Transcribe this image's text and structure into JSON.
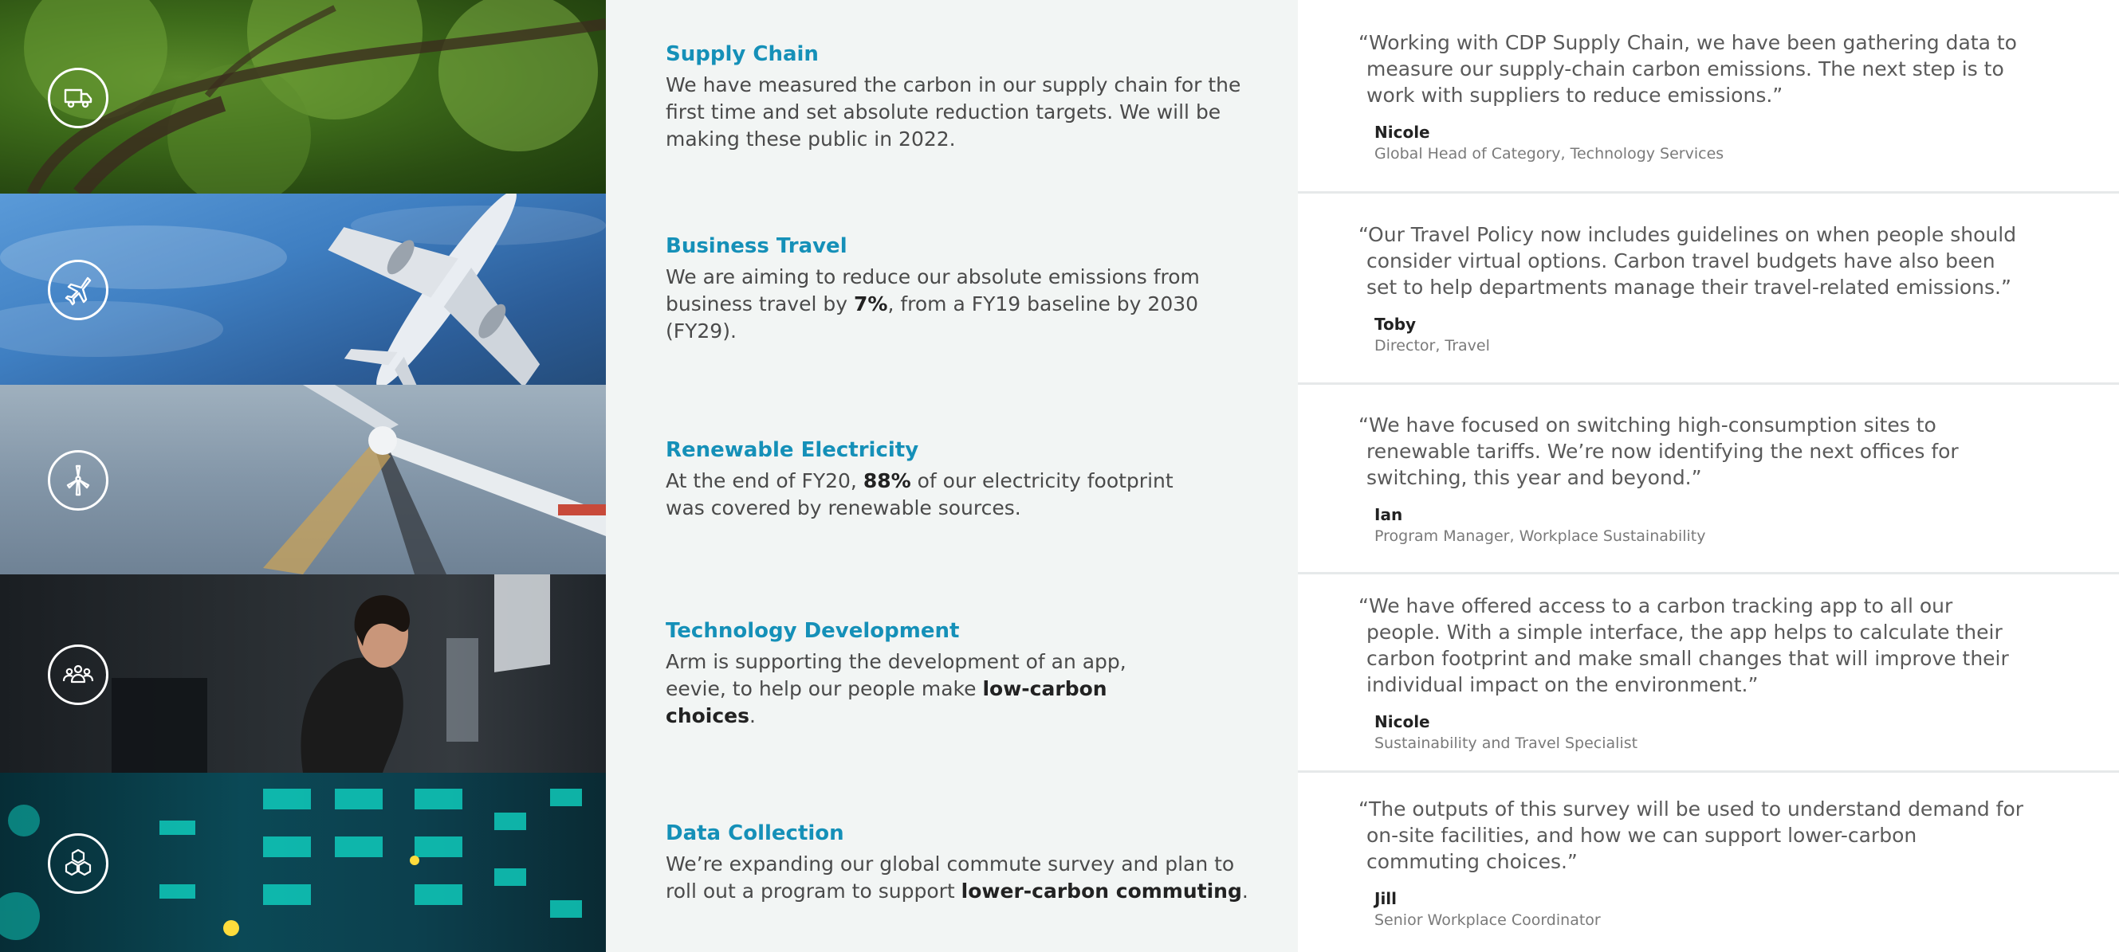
{
  "rows": [
    {
      "title": "Supply Chain",
      "body": [
        {
          "text": "We have measured the carbon in our supply chain for the first time and set absolute reduction targets. We will be making these public in 2022."
        }
      ],
      "quote": "“Working with CDP Supply Chain, we have been gathering data to measure our supply-chain carbon emissions. The next step is to work with suppliers to reduce emissions.”",
      "name": "Nicole",
      "role": "Global Head of Category, Technology Services",
      "icon": "delivery-truck-icon"
    },
    {
      "title": "Business Travel",
      "body": [
        {
          "text": "We are aiming to reduce our absolute emissions from business travel by "
        },
        {
          "bold": "7%"
        },
        {
          "text": ", from a FY19 baseline by 2030 (FY29)."
        }
      ],
      "quote": "“Our Travel Policy now includes guidelines on when people should consider virtual options. Carbon travel budgets have also been set to help departments manage their travel-related emissions.”",
      "name": "Toby",
      "role": "Director, Travel",
      "icon": "airplane-icon"
    },
    {
      "title": "Renewable Electricity",
      "body": [
        {
          "text": "At the end of FY20, "
        },
        {
          "bold": "88%"
        },
        {
          "text": " of our electricity footprint was covered by renewable sources."
        }
      ],
      "quote": "“We have focused on switching high-consumption sites to renewable tariffs. We’re now identifying the next offices for switching, this year and beyond.”",
      "name": "Ian",
      "role": "Program Manager, Workplace Sustainability",
      "icon": "wind-turbine-icon"
    },
    {
      "title": "Technology Development",
      "body": [
        {
          "text": "Arm is supporting the development of an app, eevie, to help our people make "
        },
        {
          "bold": "low-carbon choices"
        },
        {
          "text": "."
        }
      ],
      "quote": "“We have offered access to a carbon tracking app to all our people. With a simple interface, the app helps to calculate their carbon footprint and make small changes that will improve their individual impact on the environment.”",
      "name": "Nicole",
      "role": "Sustainability and Travel Specialist",
      "icon": "people-group-icon"
    },
    {
      "title": "Data Collection",
      "body": [
        {
          "text": "We’re expanding our global commute survey and plan to roll out a program to support "
        },
        {
          "bold": "lower-carbon commuting"
        },
        {
          "text": "."
        }
      ],
      "quote": "“The outputs of this survey will be used to understand demand for on-site facilities, and how we can support lower-carbon commuting choices.”",
      "name": "Jill",
      "role": "Senior Workplace Coordinator",
      "icon": "hexagons-icon"
    }
  ],
  "colors": {
    "accent": "#16b7d6",
    "title": "#1590b8",
    "panel": "#f2f5f4"
  }
}
